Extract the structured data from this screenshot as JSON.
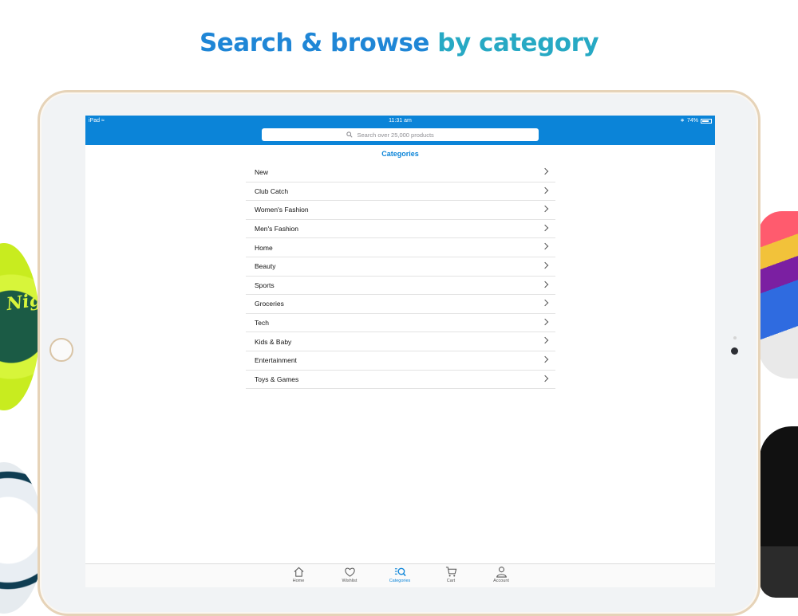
{
  "headline": {
    "part1": "Search & browse ",
    "part2": "by category"
  },
  "status_bar": {
    "device": "iPad",
    "time": "11:31 am",
    "battery": "74%"
  },
  "search": {
    "placeholder": "Search over 25,000 products"
  },
  "page_title": "Categories",
  "categories": [
    "New",
    "Club Catch",
    "Women's Fashion",
    "Men's Fashion",
    "Home",
    "Beauty",
    "Sports",
    "Groceries",
    "Tech",
    "Kids & Baby",
    "Entertainment",
    "Toys & Games"
  ],
  "tabbar": {
    "home": "Home",
    "wishlist": "Wishlist",
    "categories": "Categories",
    "cart": "Cart",
    "account": "Account"
  },
  "decor": {
    "frisbee_text": "Nigh"
  },
  "colors": {
    "accent": "#0b84d8",
    "headline_blue": "#1f86d6",
    "headline_teal": "#27a9c4"
  }
}
